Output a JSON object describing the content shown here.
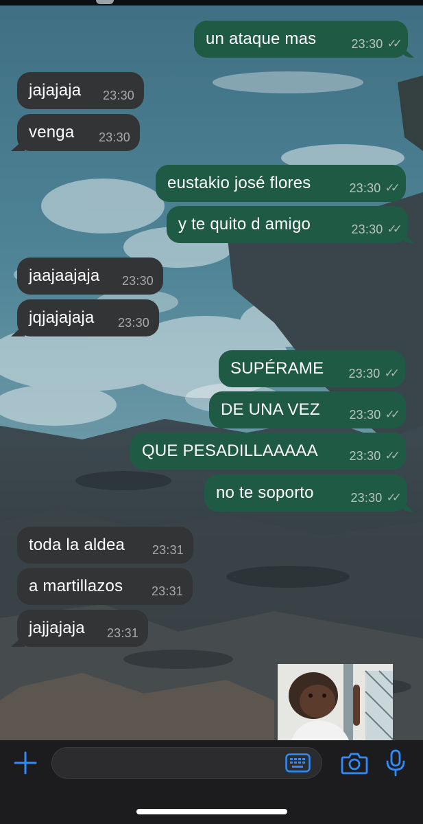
{
  "chat": {
    "messages": [
      {
        "dir": "out",
        "text": "un ataque mas",
        "time": "23:30"
      },
      {
        "dir": "in",
        "text": "jajajaja",
        "time": "23:30"
      },
      {
        "dir": "in",
        "text": "venga",
        "time": "23:30"
      },
      {
        "dir": "out",
        "text": "eustakio josé flores",
        "time": "23:30"
      },
      {
        "dir": "out",
        "text": "y te quito d amigo",
        "time": "23:30"
      },
      {
        "dir": "in",
        "text": "jaajaajaja",
        "time": "23:30"
      },
      {
        "dir": "in",
        "text": "jqjajajaja",
        "time": "23:30"
      },
      {
        "dir": "out",
        "text": "SUPÉRAME",
        "time": "23:30"
      },
      {
        "dir": "out",
        "text": "DE UNA VEZ",
        "time": "23:30"
      },
      {
        "dir": "out",
        "text": "QUE PESADILLAAAAA",
        "time": "23:30"
      },
      {
        "dir": "out",
        "text": "no te soporto",
        "time": "23:30"
      },
      {
        "dir": "in",
        "text": "toda la aldea",
        "time": "23:31"
      },
      {
        "dir": "in",
        "text": "a martillazos",
        "time": "23:31"
      },
      {
        "dir": "in",
        "text": "jajjajaja",
        "time": "23:31"
      }
    ],
    "read_ticks": "✓✓"
  },
  "input": {
    "placeholder": ""
  },
  "colors": {
    "outgoing": "#1f5a45",
    "incoming": "#333436",
    "accent": "#2f8cff",
    "bar": "#1c1c1e"
  },
  "icons": [
    "plus-icon",
    "keyboard-icon",
    "camera-icon",
    "microphone-icon"
  ]
}
